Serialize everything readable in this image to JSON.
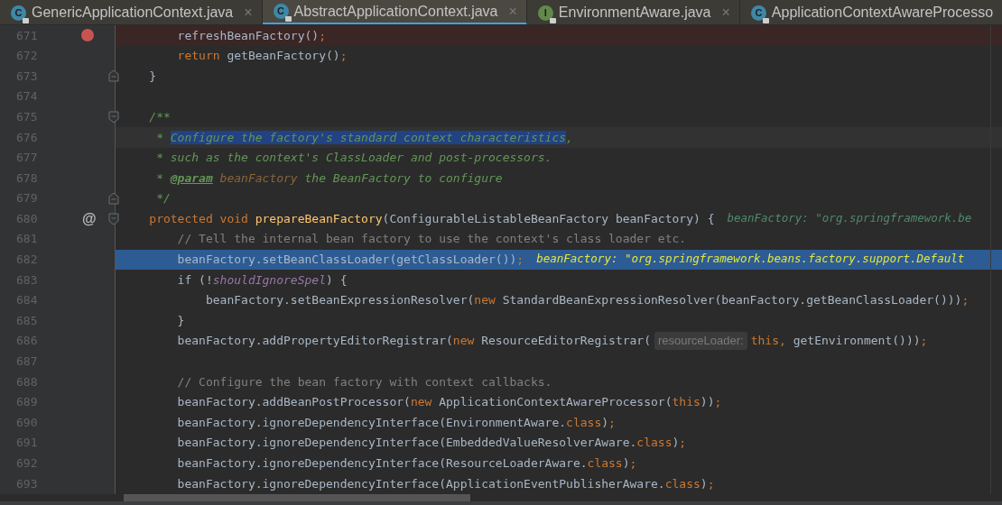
{
  "tabs": [
    {
      "label": "GenericApplicationContext.java",
      "badge": "C",
      "kind": "class",
      "selected": false,
      "close": "×"
    },
    {
      "label": "AbstractApplicationContext.java",
      "badge": "C",
      "kind": "class",
      "selected": true,
      "close": "×"
    },
    {
      "label": "EnvironmentAware.java",
      "badge": "I",
      "kind": "interface",
      "selected": false,
      "close": "×"
    },
    {
      "label": "ApplicationContextAwareProcesso",
      "badge": "C",
      "kind": "class",
      "selected": false
    }
  ],
  "lines": [
    {
      "number": "671",
      "breakpoint": true,
      "segments": [
        {
          "text": "        refreshBeanFactory()",
          "kind": "plain"
        },
        {
          "text": ";",
          "kind": "keyword"
        }
      ]
    },
    {
      "number": "672",
      "segments": [
        {
          "text": "        return",
          "kind": "keyword"
        },
        {
          "text": " getBeanFactory()",
          "kind": "plain"
        },
        {
          "text": ";",
          "kind": "keyword"
        }
      ]
    },
    {
      "number": "673",
      "fold_end": true,
      "segments": [
        {
          "text": "    }",
          "kind": "plain"
        }
      ]
    },
    {
      "number": "674"
    },
    {
      "number": "675",
      "fold_start": true,
      "segments": [
        {
          "text": "    /**",
          "kind": "doc"
        }
      ]
    },
    {
      "number": "676",
      "caret_line": true,
      "segments": [
        {
          "text": "     * ",
          "kind": "doc",
          "selected": false
        },
        {
          "text": "Configure the factory's standard context characteristics",
          "kind": "doc",
          "selected": true
        },
        {
          "text": ",",
          "kind": "doc",
          "selected": false
        }
      ]
    },
    {
      "number": "677",
      "segments": [
        {
          "text": "     * such as the context's ClassLoader and post-processors.",
          "kind": "doc"
        }
      ]
    },
    {
      "number": "678",
      "segments": [
        {
          "text": "     * ",
          "kind": "doc"
        },
        {
          "text": "@param",
          "kind": "doc-tag"
        },
        {
          "text": " beanFactory",
          "kind": "doc-param"
        },
        {
          "text": " the BeanFactory to configure",
          "kind": "doc"
        }
      ]
    },
    {
      "number": "679",
      "fold_end": true,
      "segments": [
        {
          "text": "     */",
          "kind": "doc"
        }
      ]
    },
    {
      "number": "680",
      "fold_start": true,
      "gutter_mark": "@",
      "segments": [
        {
          "text": "    protected void ",
          "kind": "keyword"
        },
        {
          "text": "prepareBeanFactory",
          "kind": "method"
        },
        {
          "text": "(ConfigurableListableBeanFactory beanFactory) {",
          "kind": "plain"
        }
      ],
      "hints": [
        {
          "text": "beanFactory: \"org.springframework.be",
          "kind": "value-hint"
        }
      ]
    },
    {
      "number": "681",
      "segments": [
        {
          "text": "        // Tell the internal bean factory to use the context's class loader etc.",
          "kind": "comment"
        }
      ]
    },
    {
      "number": "682",
      "execution_point": true,
      "segments": [
        {
          "text": "        beanFactory.setBeanClassLoader(getClassLoader())",
          "kind": "plain"
        },
        {
          "text": ";",
          "kind": "keyword"
        }
      ],
      "hints": [
        {
          "text": "beanFactory: \"org.springframework.beans.factory.support.Default",
          "kind": "value-hint"
        }
      ]
    },
    {
      "number": "683",
      "segments": [
        {
          "text": "        if (!",
          "kind": "plain"
        },
        {
          "text": "shouldIgnoreSpel",
          "kind": "static"
        },
        {
          "text": ") {",
          "kind": "plain"
        }
      ]
    },
    {
      "number": "684",
      "segments": [
        {
          "text": "            beanFactory.setBeanExpressionResolver(",
          "kind": "plain"
        },
        {
          "text": "new",
          "kind": "keyword"
        },
        {
          "text": " StandardBeanExpressionResolver(beanFactory.getBeanClassLoader()))",
          "kind": "plain"
        },
        {
          "text": ";",
          "kind": "keyword"
        }
      ]
    },
    {
      "number": "685",
      "segments": [
        {
          "text": "        }",
          "kind": "plain"
        }
      ]
    },
    {
      "number": "686",
      "segments": [
        {
          "text": "        beanFactory.addPropertyEditorRegistrar(",
          "kind": "plain"
        },
        {
          "text": "new",
          "kind": "keyword"
        },
        {
          "text": " ResourceEditorRegistrar(",
          "kind": "plain"
        },
        {
          "text": "resourceLoader:",
          "kind": "param-hint"
        },
        {
          "text": "this,",
          "kind": "keyword"
        },
        {
          "text": " getEnvironment()))",
          "kind": "plain"
        },
        {
          "text": ";",
          "kind": "keyword"
        }
      ]
    },
    {
      "number": "687"
    },
    {
      "number": "688",
      "segments": [
        {
          "text": "        // Configure the bean factory with context callbacks.",
          "kind": "comment"
        }
      ]
    },
    {
      "number": "689",
      "segments": [
        {
          "text": "        beanFactory.addBeanPostProcessor(",
          "kind": "plain"
        },
        {
          "text": "new",
          "kind": "keyword"
        },
        {
          "text": " ApplicationContextAwareProcessor(",
          "kind": "plain"
        },
        {
          "text": "this",
          "kind": "keyword"
        },
        {
          "text": "))",
          "kind": "plain"
        },
        {
          "text": ";",
          "kind": "keyword"
        }
      ]
    },
    {
      "number": "690",
      "segments": [
        {
          "text": "        beanFactory.ignoreDependencyInterface(EnvironmentAware.",
          "kind": "plain"
        },
        {
          "text": "class",
          "kind": "keyword"
        },
        {
          "text": ")",
          "kind": "plain"
        },
        {
          "text": ";",
          "kind": "keyword"
        }
      ]
    },
    {
      "number": "691",
      "segments": [
        {
          "text": "        beanFactory.ignoreDependencyInterface(EmbeddedValueResolverAware.",
          "kind": "plain"
        },
        {
          "text": "class",
          "kind": "keyword"
        },
        {
          "text": ")",
          "kind": "plain"
        },
        {
          "text": ";",
          "kind": "keyword"
        }
      ]
    },
    {
      "number": "692",
      "segments": [
        {
          "text": "        beanFactory.ignoreDependencyInterface(ResourceLoaderAware.",
          "kind": "plain"
        },
        {
          "text": "class",
          "kind": "keyword"
        },
        {
          "text": ")",
          "kind": "plain"
        },
        {
          "text": ";",
          "kind": "keyword"
        }
      ]
    },
    {
      "number": "693",
      "segments": [
        {
          "text": "        beanFactory.ignoreDependencyInterface(ApplicationEventPublisherAware.",
          "kind": "plain"
        },
        {
          "text": "class",
          "kind": "keyword"
        },
        {
          "text": ")",
          "kind": "plain"
        },
        {
          "text": ";",
          "kind": "keyword"
        }
      ]
    }
  ]
}
